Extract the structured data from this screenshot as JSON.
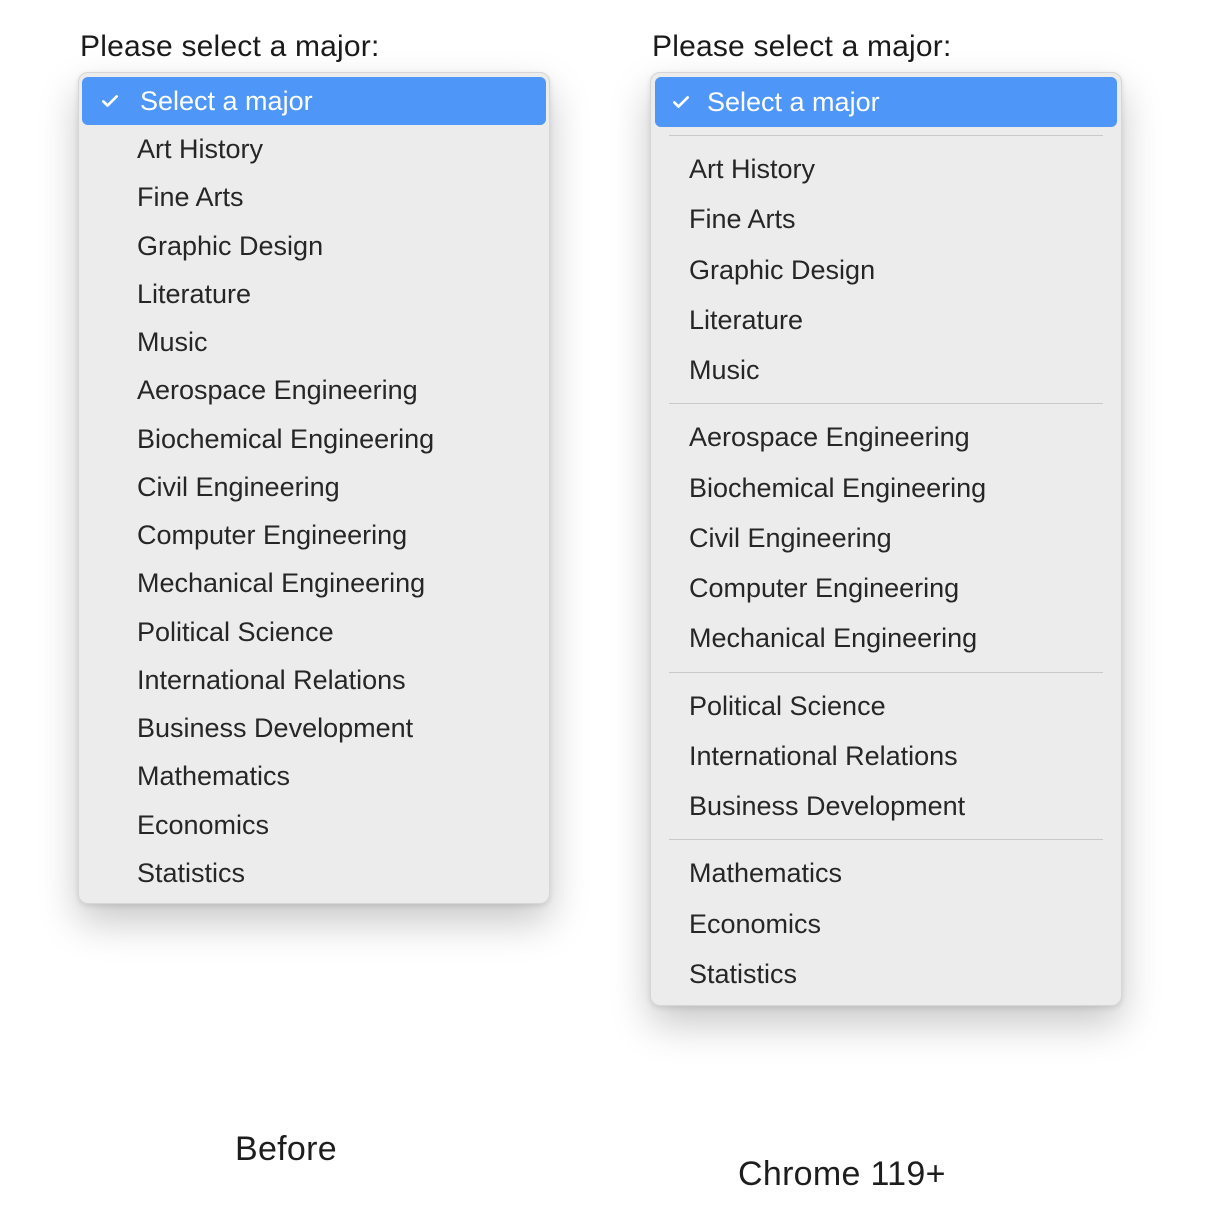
{
  "prompt_label": "Please select a major:",
  "selected_label": "Select a major",
  "captions": {
    "before": "Before",
    "after": "Chrome 119+"
  },
  "before_options": [
    "Art History",
    "Fine Arts",
    "Graphic Design",
    "Literature",
    "Music",
    "Aerospace Engineering",
    "Biochemical Engineering",
    "Civil Engineering",
    "Computer Engineering",
    "Mechanical Engineering",
    "Political Science",
    "International Relations",
    "Business Development",
    "Mathematics",
    "Economics",
    "Statistics"
  ],
  "after_groups": [
    [
      "Art History",
      "Fine Arts",
      "Graphic Design",
      "Literature",
      "Music"
    ],
    [
      "Aerospace Engineering",
      "Biochemical Engineering",
      "Civil Engineering",
      "Computer Engineering",
      "Mechanical Engineering"
    ],
    [
      "Political Science",
      "International Relations",
      "Business Development"
    ],
    [
      "Mathematics",
      "Economics",
      "Statistics"
    ]
  ]
}
